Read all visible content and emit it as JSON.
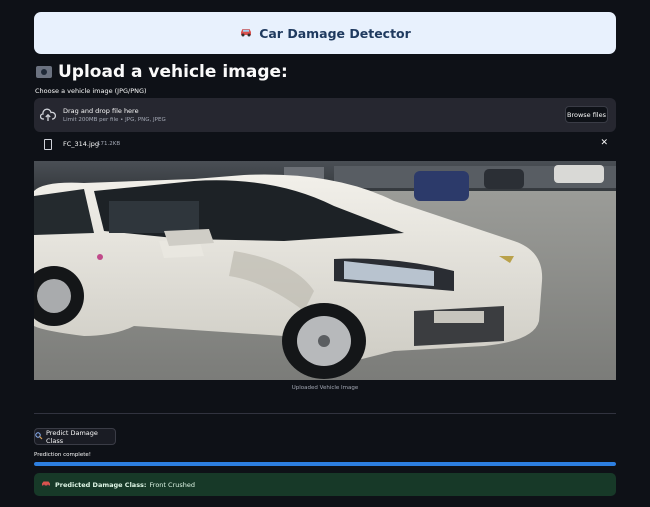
{
  "header": {
    "title": "Car Damage Detector",
    "icon": "car-icon"
  },
  "upload": {
    "heading": "Upload a vehicle image:",
    "label": "Choose a vehicle image (JPG/PNG)",
    "drop_text": "Drag and drop file here",
    "limit_text": "Limit 200MB per file • JPG, PNG, JPEG",
    "browse_label": "Browse files"
  },
  "file": {
    "name": "FC_314.jpg",
    "size": "171.2KB"
  },
  "image": {
    "caption": "Uploaded Vehicle Image"
  },
  "predict": {
    "button_label": "Predict Damage Class"
  },
  "progress": {
    "status": "Prediction complete!",
    "value": 1.0
  },
  "result": {
    "label": "Predicted Damage Class:",
    "value": "Front Crushed"
  },
  "colors": {
    "background": "#0e1117",
    "accent": "#2d7fe0",
    "success_bg": "#173928",
    "header_bg": "#e8f1fd"
  }
}
